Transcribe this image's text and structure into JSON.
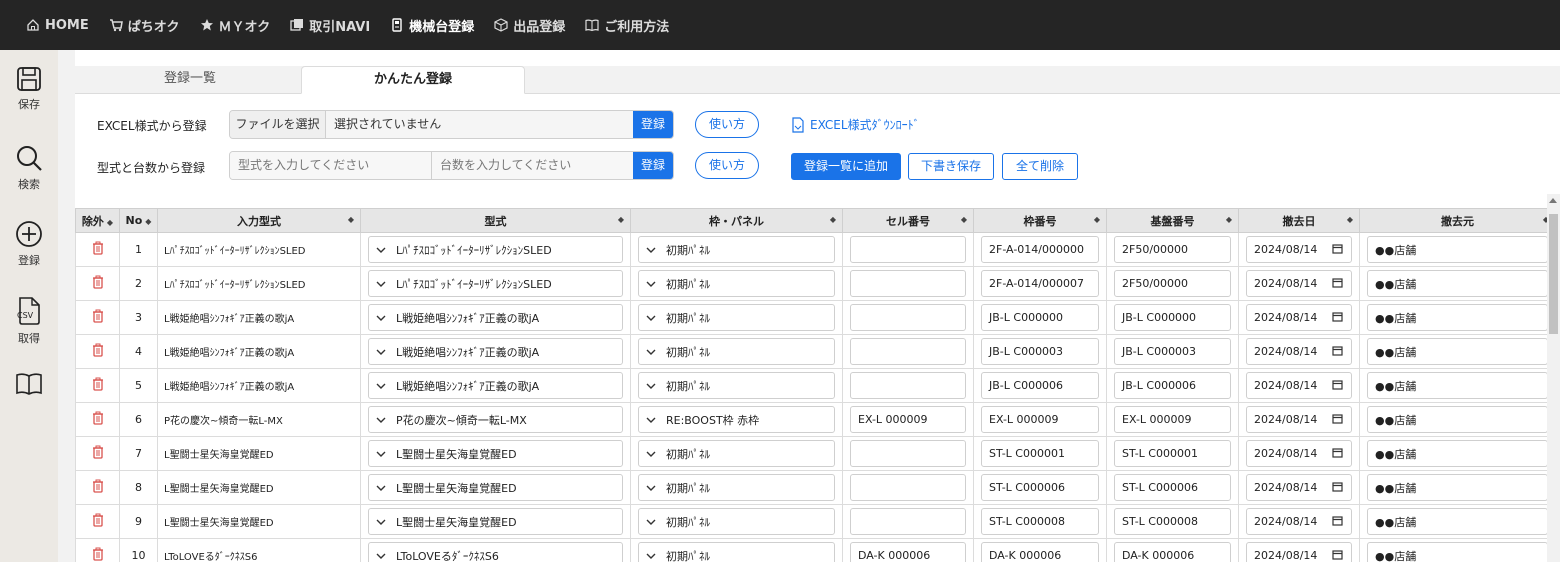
{
  "nav": {
    "items": [
      {
        "label": "HOME",
        "icon": "home-icon"
      },
      {
        "label": "ぱちオク",
        "icon": "cart-icon"
      },
      {
        "label": "ＭＹオク",
        "icon": "star-icon"
      },
      {
        "label": "取引NAVI",
        "icon": "window-icon"
      },
      {
        "label": "機械台登録",
        "icon": "machine-icon"
      },
      {
        "label": "出品登録",
        "icon": "box-icon"
      },
      {
        "label": "ご利用方法",
        "icon": "book-icon"
      }
    ],
    "active": "機械台登録"
  },
  "sidebar": {
    "save": "保存",
    "search": "検索",
    "register": "登録",
    "fetch": "取得",
    "csv_text": "CSV"
  },
  "tabs": {
    "list": "登録一覧",
    "easy": "かんたん登録"
  },
  "excel_row": {
    "label": "EXCEL様式から登録",
    "file_button": "ファイルを選択",
    "file_status": "選択されていません",
    "register": "登録",
    "howto": "使い方",
    "download": "EXCEL様式ﾀﾞｳﾝﾛｰﾄﾞ"
  },
  "model_row": {
    "label": "型式と台数から登録",
    "model_placeholder": "型式を入力してください",
    "count_placeholder": "台数を入力してください",
    "register": "登録",
    "howto": "使い方",
    "add_to_list": "登録一覧に追加",
    "draft_save": "下書き保存",
    "delete_all": "全て削除"
  },
  "table": {
    "headers": {
      "exclude": "除外",
      "no": "No",
      "input_model": "入力型式",
      "model": "型式",
      "frame_panel": "枠・パネル",
      "cell_no": "セル番号",
      "frame_no": "枠番号",
      "board_no": "基盤番号",
      "removal_date": "撤去日",
      "removal_source": "撤去元"
    },
    "sort_glyph": "◆",
    "rows": [
      {
        "no": "1",
        "input": "LﾊﾟﾁｽﾛｺﾞｯﾄﾞｲｰﾀｰﾘｻﾞﾚｸｼｮﾝSLED",
        "model": "LﾊﾟﾁｽﾛｺﾞｯﾄﾞｲｰﾀｰﾘｻﾞﾚｸｼｮﾝSLED",
        "panel": "初期ﾊﾟﾈﾙ",
        "cell": "",
        "frame": "2F-A-014/000000",
        "board": "2F50/00000",
        "date": "2024/08/14",
        "source": "●●店舗"
      },
      {
        "no": "2",
        "input": "LﾊﾟﾁｽﾛｺﾞｯﾄﾞｲｰﾀｰﾘｻﾞﾚｸｼｮﾝSLED",
        "model": "LﾊﾟﾁｽﾛｺﾞｯﾄﾞｲｰﾀｰﾘｻﾞﾚｸｼｮﾝSLED",
        "panel": "初期ﾊﾟﾈﾙ",
        "cell": "",
        "frame": "2F-A-014/000007",
        "board": "2F50/00000",
        "date": "2024/08/14",
        "source": "●●店舗"
      },
      {
        "no": "3",
        "input": "L戦姫絶唱ｼﾝﾌｫｷﾞｱ正義の歌jA",
        "model": "L戦姫絶唱ｼﾝﾌｫｷﾞｱ正義の歌jA",
        "panel": "初期ﾊﾟﾈﾙ",
        "cell": "",
        "frame": "JB-L C000000",
        "board": "JB-L C000000",
        "date": "2024/08/14",
        "source": "●●店舗"
      },
      {
        "no": "4",
        "input": "L戦姫絶唱ｼﾝﾌｫｷﾞｱ正義の歌jA",
        "model": "L戦姫絶唱ｼﾝﾌｫｷﾞｱ正義の歌jA",
        "panel": "初期ﾊﾟﾈﾙ",
        "cell": "",
        "frame": "JB-L C000003",
        "board": "JB-L C000003",
        "date": "2024/08/14",
        "source": "●●店舗"
      },
      {
        "no": "5",
        "input": "L戦姫絶唱ｼﾝﾌｫｷﾞｱ正義の歌jA",
        "model": "L戦姫絶唱ｼﾝﾌｫｷﾞｱ正義の歌jA",
        "panel": "初期ﾊﾟﾈﾙ",
        "cell": "",
        "frame": "JB-L C000006",
        "board": "JB-L C000006",
        "date": "2024/08/14",
        "source": "●●店舗"
      },
      {
        "no": "6",
        "input": "P花の慶次~傾奇一転L-MX",
        "model": "P花の慶次~傾奇一転L-MX",
        "panel": "RE:BOOST枠 赤枠",
        "cell": "EX-L 000009",
        "frame": "EX-L 000009",
        "board": "EX-L 000009",
        "date": "2024/08/14",
        "source": "●●店舗"
      },
      {
        "no": "7",
        "input": "L聖闘士星矢海皇覚醒ED",
        "model": "L聖闘士星矢海皇覚醒ED",
        "panel": "初期ﾊﾟﾈﾙ",
        "cell": "",
        "frame": "ST-L C000001",
        "board": "ST-L C000001",
        "date": "2024/08/14",
        "source": "●●店舗"
      },
      {
        "no": "8",
        "input": "L聖闘士星矢海皇覚醒ED",
        "model": "L聖闘士星矢海皇覚醒ED",
        "panel": "初期ﾊﾟﾈﾙ",
        "cell": "",
        "frame": "ST-L C000006",
        "board": "ST-L C000006",
        "date": "2024/08/14",
        "source": "●●店舗"
      },
      {
        "no": "9",
        "input": "L聖闘士星矢海皇覚醒ED",
        "model": "L聖闘士星矢海皇覚醒ED",
        "panel": "初期ﾊﾟﾈﾙ",
        "cell": "",
        "frame": "ST-L C000008",
        "board": "ST-L C000008",
        "date": "2024/08/14",
        "source": "●●店舗"
      },
      {
        "no": "10",
        "input": "LToLOVEるﾀﾞｰｸﾈｽS6",
        "model": "LToLOVEるﾀﾞｰｸﾈｽS6",
        "panel": "初期ﾊﾟﾈﾙ",
        "cell": "DA-K 000006",
        "frame": "DA-K 000006",
        "board": "DA-K 000006",
        "date": "2024/08/14",
        "source": "●●店舗"
      }
    ]
  },
  "colors": {
    "accent": "#1a73e8",
    "nav_bg": "#252525",
    "trash": "#d9534f"
  }
}
